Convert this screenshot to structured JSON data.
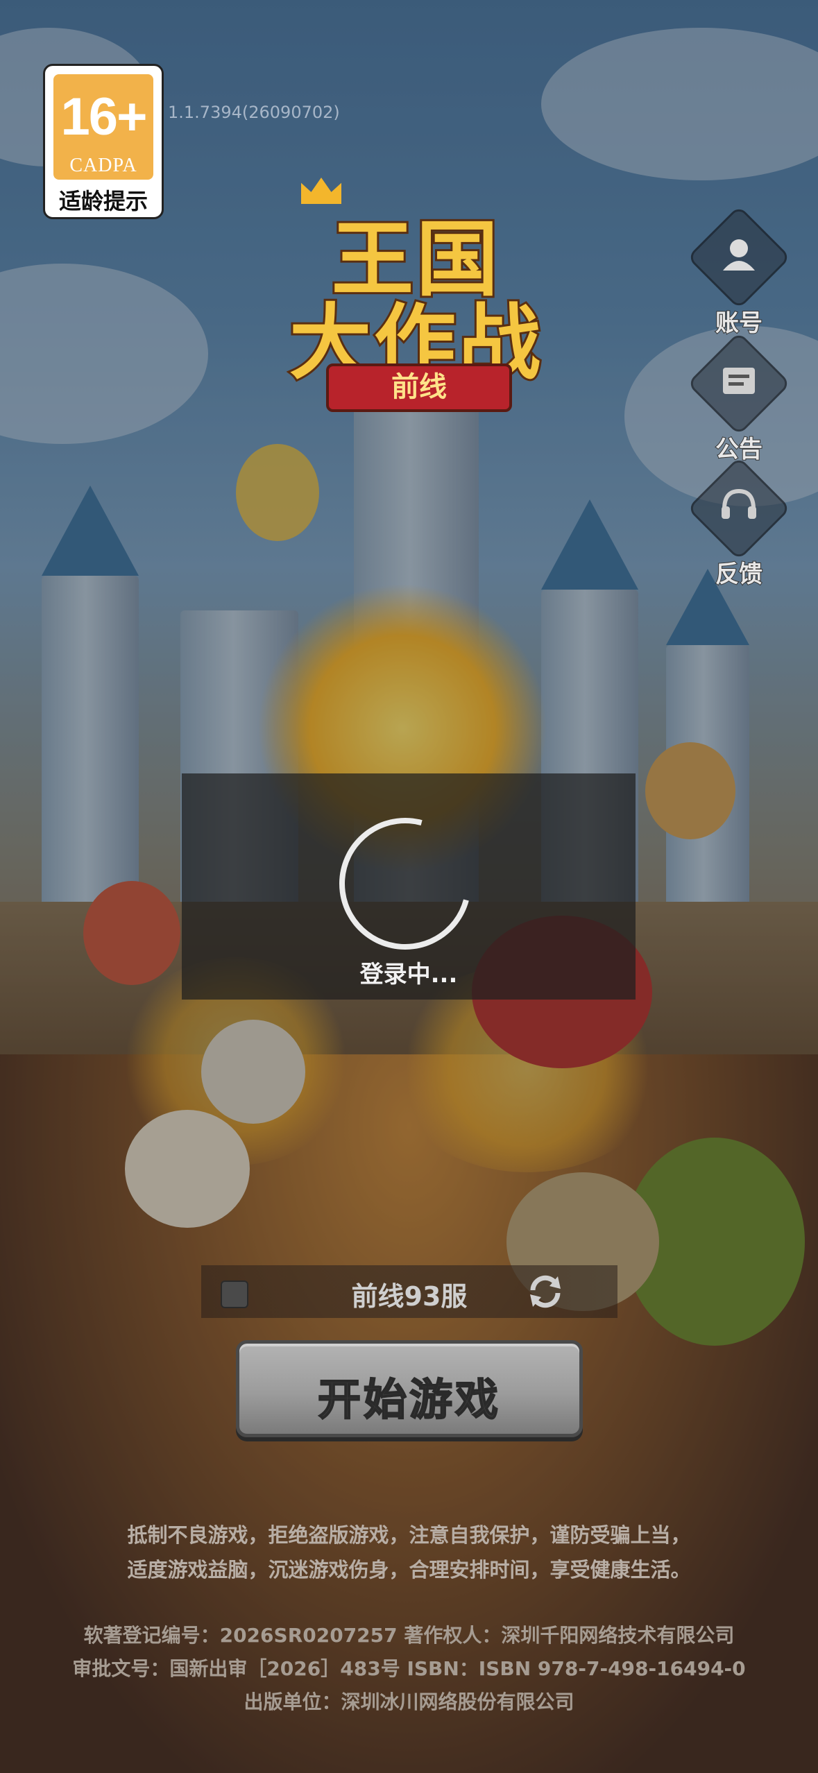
{
  "age_badge": {
    "rating": "16+",
    "org": "CADPA",
    "tip": "适龄提示"
  },
  "version": "1.1.7394(26090702)",
  "logo": {
    "line1": "王国",
    "line2": "大作战",
    "ribbon": "前线"
  },
  "side_menu": {
    "account": "账号",
    "announcement": "公告",
    "feedback": "反馈"
  },
  "loading": {
    "text": "登录中..."
  },
  "server": {
    "name": "前线93服"
  },
  "start_button": "开始游戏",
  "health_notice": {
    "line1": "抵制不良游戏，拒绝盗版游戏，注意自我保护，谨防受骗上当，",
    "line2": "适度游戏益脑，沉迷游戏伤身，合理安排时间，享受健康生活。"
  },
  "copyright": {
    "line1": "软著登记编号：2026SR0207257 著作权人：深圳千阳网络技术有限公司",
    "line2": "审批文号：国新出审［2026］483号 ISBN：ISBN 978-7-498-16494-0",
    "line3": "出版单位：深圳冰川网络股份有限公司"
  },
  "colors": {
    "badge_orange": "#f2b24a",
    "logo_gold": "#f5c641",
    "ribbon_red": "#b8232b",
    "start_button_gray": "#9c9c9c"
  }
}
